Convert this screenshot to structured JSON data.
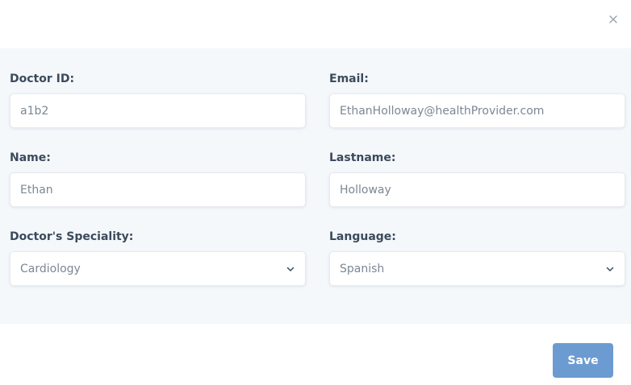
{
  "form": {
    "doctor_id": {
      "label": "Doctor ID:",
      "value": "a1b2"
    },
    "email": {
      "label": "Email:",
      "value": "EthanHolloway@healthProvider.com"
    },
    "name": {
      "label": "Name:",
      "value": "Ethan"
    },
    "lastname": {
      "label": "Lastname:",
      "value": "Holloway"
    },
    "speciality": {
      "label": "Doctor's Speciality:",
      "selected": "Cardiology"
    },
    "language": {
      "label": "Language:",
      "selected": "Spanish"
    }
  },
  "footer": {
    "save_label": "Save"
  },
  "icons": {
    "close": "close-icon",
    "dropdown": "chevron-down-icon"
  },
  "colors": {
    "body_bg": "#f4f8fb",
    "save_button": "#6b9bd1",
    "label_text": "#3b4a5c"
  }
}
